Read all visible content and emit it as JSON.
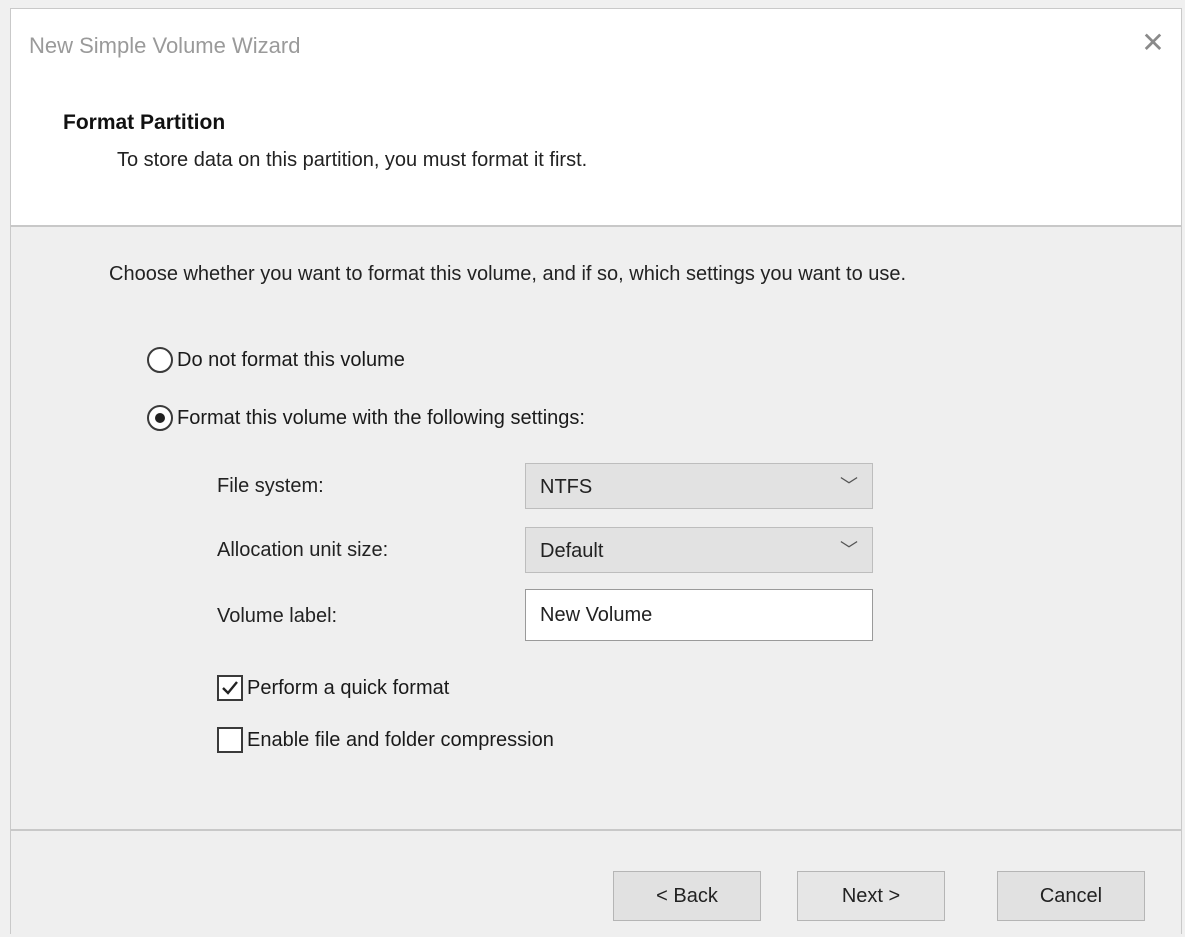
{
  "window": {
    "title": "New Simple Volume Wizard",
    "close_glyph": "✕"
  },
  "header": {
    "title": "Format Partition",
    "subtitle": "To store data on this partition, you must format it first."
  },
  "content": {
    "intro": "Choose whether you want to format this volume, and if so, which settings you want to use.",
    "options": {
      "do_not_format": {
        "label": "Do not format this volume",
        "selected": false
      },
      "format": {
        "label": "Format this volume with the following settings:",
        "selected": true
      }
    },
    "file_system": {
      "label": "File system:",
      "value": "NTFS"
    },
    "allocation_unit_size": {
      "label": "Allocation unit size:",
      "value": "Default"
    },
    "volume_label": {
      "label": "Volume label:",
      "value": "New Volume"
    },
    "quick_format": {
      "label": "Perform a quick format",
      "checked": true
    },
    "compression": {
      "label": "Enable file and folder compression",
      "checked": false
    }
  },
  "footer": {
    "back_label": "< Back",
    "next_label": "Next >",
    "cancel_label": "Cancel"
  },
  "colors": {
    "window_bg": "#efefef",
    "header_bg": "#ffffff",
    "button_bg": "#e1e1e1"
  }
}
